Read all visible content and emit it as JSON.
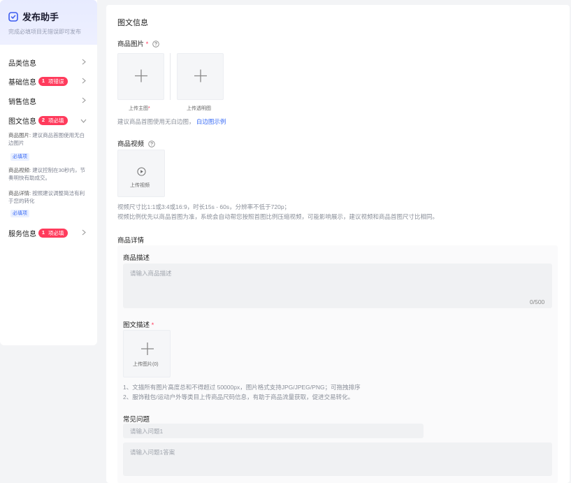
{
  "assistant": {
    "title": "发布助手",
    "subtitle": "完成必填项目无错误即可发布"
  },
  "nav": {
    "category": "品类信息",
    "basic": "基础信息",
    "basic_badge_num": "1",
    "basic_badge_text": "项错误",
    "sales": "销售信息",
    "graphic": "图文信息",
    "graphic_badge_num": "2",
    "graphic_badge_text": "项必填",
    "service": "服务信息",
    "service_badge_num": "1",
    "service_badge_text": "项必填"
  },
  "notes": {
    "image_key": "商品图片:",
    "image_text": "建议商品首图使用无白边图片",
    "video_key": "商品视频:",
    "video_text": "建议控制在30秒内，节奏明快有助成交。",
    "detail_key": "商品详情:",
    "detail_text": "按照建议调整简洁有利于您的转化",
    "required_tag": "必填项"
  },
  "main": {
    "section_title": "图文信息",
    "image_label": "商品图片",
    "star": "*",
    "upload_main": "上传主图",
    "upload_transparent": "上传透明图",
    "image_hint": "建议商品首图使用无白边图，",
    "image_hint_link": "白边图示例",
    "video_label": "商品视频",
    "upload_video": "上传视频",
    "video_hint_1": "视频尺寸比1:1或3:4或16:9，时长15s - 60s，分辨率不低于720p；",
    "video_hint_2": "视频比例优先以商品首图为准，系统会自动帮您按照首图比例压缩视频，可能影响展示，建议视频和商品首图尺寸比相同。",
    "detail_title": "商品详情",
    "desc_label": "商品描述",
    "desc_placeholder": "请输入商品描述",
    "desc_counter": "0/500",
    "graphic_desc_label": "图文描述",
    "upload_images": "上传图片(0)",
    "graphic_hint_1": "1、文描所有图片高度总和不得超过 50000px，图片格式支持JPG/JPEG/PNG；可拖拽排序",
    "graphic_hint_2": "2、服饰鞋包/运动户外等类目上传商品尺码信息，有助于商品流量获取，促进交易转化。",
    "faq_label": "常见问题",
    "faq_q_placeholder": "请输入问题1",
    "faq_a_placeholder": "请输入问题1答案"
  },
  "colors": {
    "accent": "#3a6cf6",
    "badge": "#ff3b5c"
  }
}
